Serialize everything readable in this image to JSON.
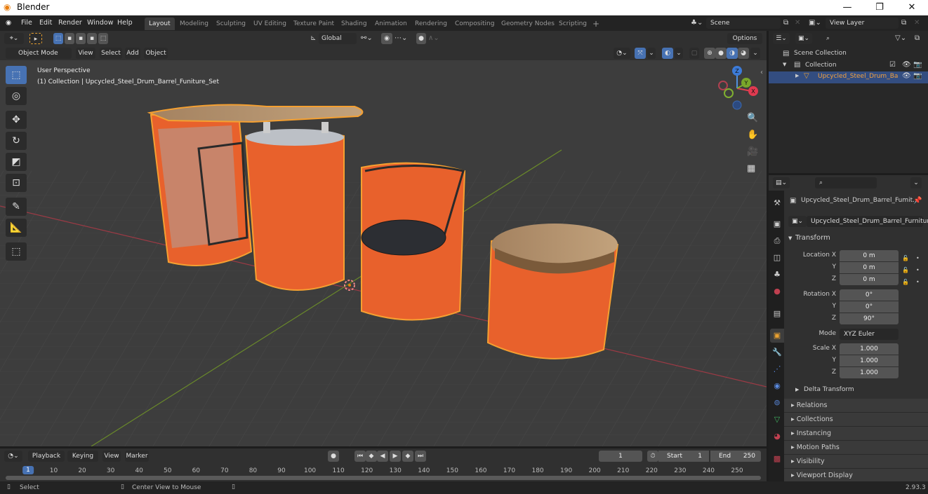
{
  "window": {
    "title": "Blender",
    "minimize": "—",
    "maximize": "❐",
    "close": "✕"
  },
  "menu": [
    "File",
    "Edit",
    "Render",
    "Window",
    "Help"
  ],
  "workspaces": [
    "Layout",
    "Modeling",
    "Sculpting",
    "UV Editing",
    "Texture Paint",
    "Shading",
    "Animation",
    "Rendering",
    "Compositing",
    "Geometry Nodes",
    "Scripting"
  ],
  "active_workspace": "Layout",
  "add_workspace": "+",
  "scene": {
    "name": "Scene",
    "view_layer": "View Layer"
  },
  "viewport": {
    "mode": "Object Mode",
    "menus": [
      "View",
      "Select",
      "Add",
      "Object"
    ],
    "orientation": "Global",
    "options": "Options",
    "overlay_line1": "User Perspective",
    "overlay_line2": "(1) Collection | Upcycled_Steel_Drum_Barrel_Funiture_Set",
    "gizmo": {
      "z": "Z",
      "y": "Y",
      "x": "X"
    },
    "colors": {
      "orange": "#e8612c",
      "outline": "#f5a031",
      "grid_x": "#9c3a45",
      "grid_y": "#6a8a2a",
      "bg": "#3d3d3d"
    }
  },
  "outliner": {
    "scene_collection": "Scene Collection",
    "collection": "Collection",
    "object": "Upcycled_Steel_Drum_Ba"
  },
  "properties": {
    "object_name": "Upcycled_Steel_Drum_Barrel_Fumit...",
    "datablock": "Upcycled_Steel_Drum_Barrel_Furniture_...",
    "transform_title": "Transform",
    "location": {
      "label": "Location X",
      "x": "0 m",
      "y": "0 m",
      "z": "0 m"
    },
    "rotation": {
      "label": "Rotation X",
      "x": "0°",
      "y": "0°",
      "z": "90°"
    },
    "mode_label": "Mode",
    "mode_value": "XYZ Euler",
    "scale": {
      "label": "Scale X",
      "x": "1.000",
      "y": "1.000",
      "z": "1.000"
    },
    "axis_y": "Y",
    "axis_z": "Z",
    "delta": "Delta Transform",
    "panels": [
      "Relations",
      "Collections",
      "Instancing",
      "Motion Paths",
      "Visibility",
      "Viewport Display"
    ]
  },
  "timeline": {
    "menus": [
      "Playback",
      "Keying",
      "View",
      "Marker"
    ],
    "current_frame": "1",
    "start_label": "Start",
    "start": "1",
    "end_label": "End",
    "end": "250",
    "ticks": [
      "1",
      "10",
      "20",
      "30",
      "40",
      "50",
      "60",
      "70",
      "80",
      "90",
      "100",
      "110",
      "120",
      "130",
      "140",
      "150",
      "160",
      "170",
      "180",
      "190",
      "200",
      "210",
      "220",
      "230",
      "240",
      "250"
    ]
  },
  "status": {
    "select": "Select",
    "center": "Center View to Mouse",
    "version": "2.93.3"
  }
}
